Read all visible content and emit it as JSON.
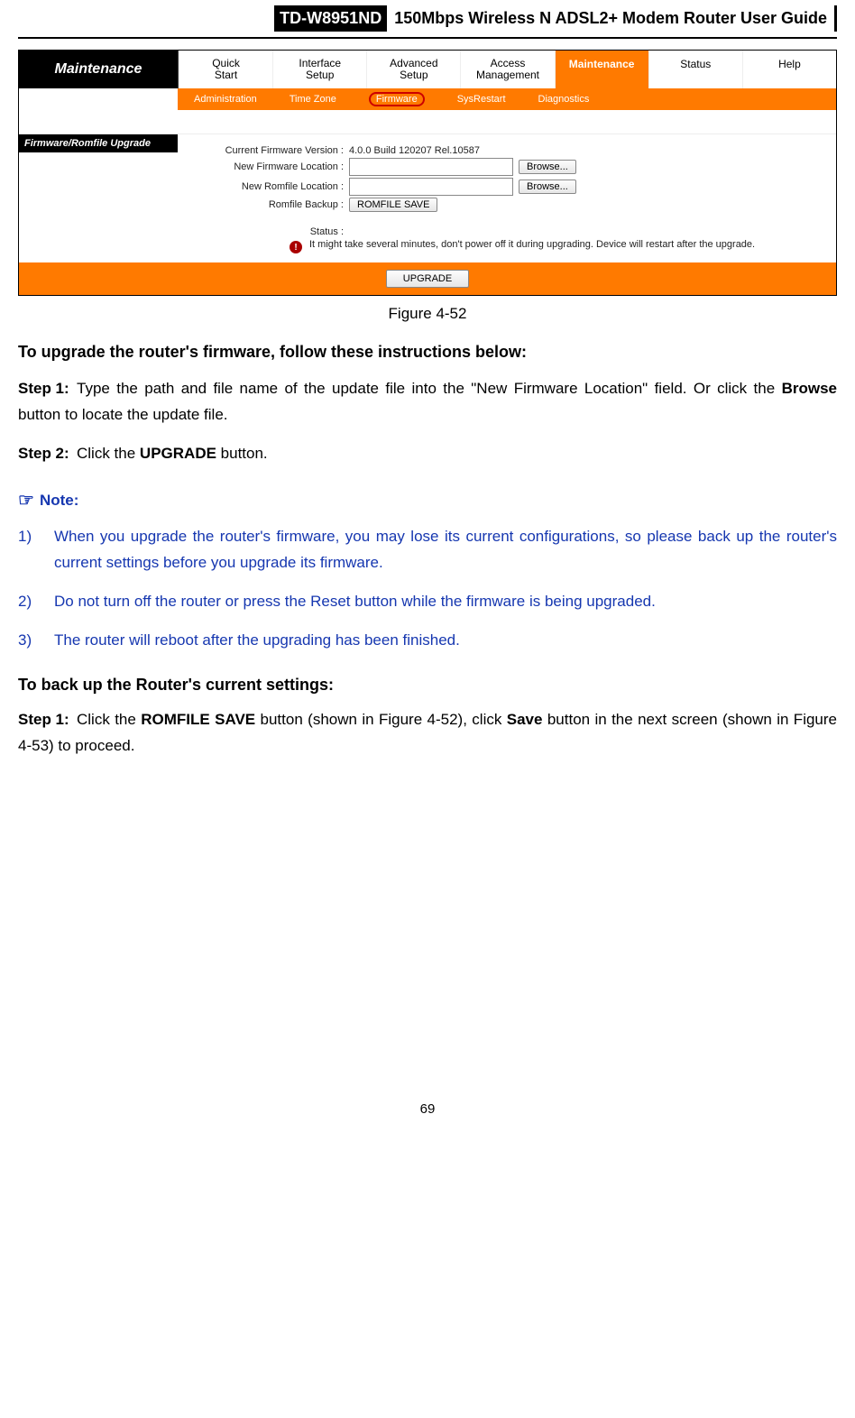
{
  "doc": {
    "model": "TD-W8951ND",
    "title": "150Mbps Wireless N ADSL2+ Modem Router User Guide",
    "page_number": "69"
  },
  "screenshot": {
    "sidebar_title": "Maintenance",
    "tabs": [
      {
        "l1": "Quick",
        "l2": "Start"
      },
      {
        "l1": "Interface",
        "l2": "Setup"
      },
      {
        "l1": "Advanced",
        "l2": "Setup"
      },
      {
        "l1": "Access",
        "l2": "Management"
      },
      {
        "l1": "Maintenance",
        "active": true
      },
      {
        "l1": "Status"
      },
      {
        "l1": "Help"
      }
    ],
    "subtabs": [
      "Administration",
      "Time Zone",
      "Firmware",
      "SysRestart",
      "Diagnostics"
    ],
    "subtab_selected_index": 2,
    "section_header": "Firmware/Romfile Upgrade",
    "rows": {
      "fw_version_label": "Current Firmware Version :",
      "fw_version_value": "4.0.0 Build 120207 Rel.10587",
      "new_fw_label": "New Firmware Location :",
      "new_rom_label": "New Romfile Location :",
      "rom_backup_label": "Romfile Backup :",
      "browse_btn": "Browse...",
      "romfile_save_btn": "ROMFILE SAVE",
      "status_label": "Status :",
      "status_text": "It might take several minutes, don't power off it during upgrading. Device will restart after the upgrade."
    },
    "upgrade_btn": "UPGRADE",
    "caption": "Figure 4-52"
  },
  "body": {
    "upgrade_heading": "To upgrade the router's firmware, follow these instructions below:",
    "steps_upgrade": [
      {
        "label": "Step 1:",
        "pre": "Type the path and file name of the update file into the \"New Firmware Location\" field. Or click the ",
        "bold1": "Browse",
        "post": " button to locate the update file."
      },
      {
        "label": "Step 2:",
        "pre": "Click the ",
        "bold1": "UPGRADE",
        "post": " button."
      }
    ],
    "note_label": "Note:",
    "notes": [
      "When you upgrade the router's firmware, you may lose its current configurations, so please back up the router's current settings before you upgrade its firmware.",
      "Do not turn off the router or press the Reset button while the firmware is being upgraded.",
      "The router will reboot after the upgrading has been finished."
    ],
    "backup_heading": "To back up the Router's current settings:",
    "backup_step": {
      "label": "Step 1:",
      "p1": "Click the ",
      "b1": "ROMFILE SAVE",
      "p2": " button (shown in Figure 4-52), click ",
      "b2": "Save",
      "p3": " button in the next screen (shown in Figure 4-53) to proceed."
    }
  }
}
